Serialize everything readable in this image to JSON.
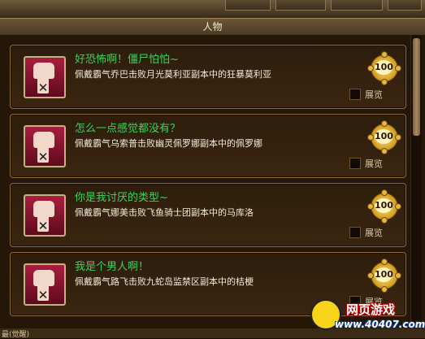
{
  "window": {
    "title": "人物"
  },
  "achievements": [
    {
      "title": "好恐怖啊！僵尸怕怕~",
      "description": "佩戴霸气乔巴击败月光莫利亚副本中的狂暴莫利亚",
      "points": "100",
      "browse_label": "展览"
    },
    {
      "title": "怎么一点感觉都没有？",
      "description": "佩戴霸气乌索普击败幽灵佩罗娜副本中的佩罗娜",
      "points": "100",
      "browse_label": "展览"
    },
    {
      "title": "你是我讨厌的类型~",
      "description": "佩戴霸气娜美击败飞鱼骑士团副本中的马库洛",
      "points": "100",
      "browse_label": "展览"
    },
    {
      "title": "我是个男人啊！",
      "description": "佩戴霸气路飞击败九蛇岛监禁区副本中的桔梗",
      "points": "100",
      "browse_label": "展览"
    }
  ],
  "watermark": {
    "line1": "网页游戏",
    "line2": "www.40407.com"
  },
  "footer": {
    "partial_text": "最(觉醒)"
  }
}
